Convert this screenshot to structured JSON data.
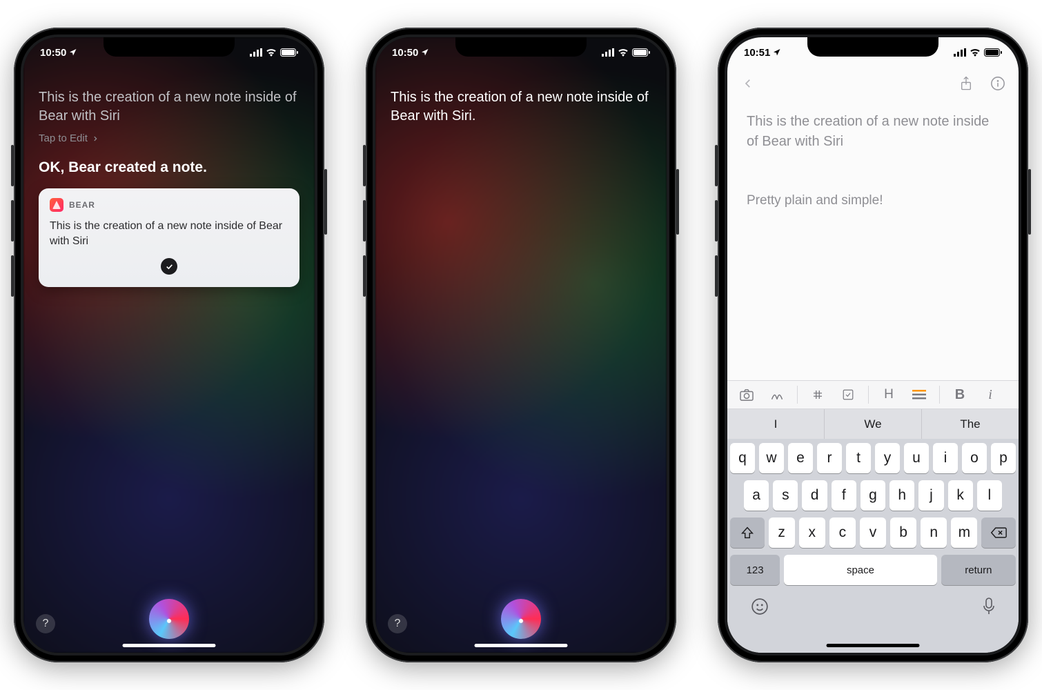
{
  "status": {
    "time_dark": "10:50",
    "time_light": "10:51"
  },
  "screen1": {
    "utterance": "This is the creation of a new note inside of Bear with Siri",
    "tap_to_edit": "Tap to Edit",
    "response": "OK, Bear created a note.",
    "card": {
      "app_name": "BEAR",
      "body": "This is the creation of a new note inside of Bear with Siri"
    }
  },
  "screen2": {
    "utterance": "This is the creation of a new note inside of Bear with Siri."
  },
  "screen3": {
    "note_title": "This is the creation of a new note inside of Bear with Siri",
    "note_body": "Pretty plain and simple!",
    "format_toolbar": {
      "heading": "H",
      "bold": "B",
      "italic": "i"
    },
    "suggestions": [
      "I",
      "We",
      "The"
    ],
    "keyboard": {
      "row1": [
        "q",
        "w",
        "e",
        "r",
        "t",
        "y",
        "u",
        "i",
        "o",
        "p"
      ],
      "row2": [
        "a",
        "s",
        "d",
        "f",
        "g",
        "h",
        "j",
        "k",
        "l"
      ],
      "row3": [
        "z",
        "x",
        "c",
        "v",
        "b",
        "n",
        "m"
      ],
      "mode_key": "123",
      "space": "space",
      "return": "return"
    }
  }
}
